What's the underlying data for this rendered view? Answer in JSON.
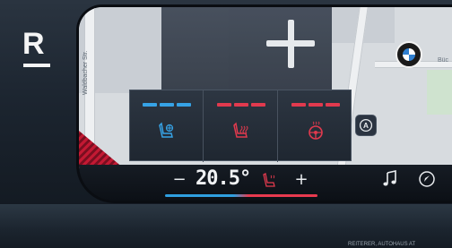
{
  "watermark": {
    "logo_letter": "R"
  },
  "map": {
    "street_label": "Waldbacher Str.",
    "right_label": "Büc"
  },
  "climate": {
    "buttons": [
      {
        "name": "seat-ventilation",
        "icon": "seat-fan-icon",
        "level_color": "#36a3e6",
        "levels_active": 3
      },
      {
        "name": "seat-heating",
        "icon": "seat-heat-icon",
        "level_color": "#e23a4e",
        "levels_active": 3
      },
      {
        "name": "steering-wheel-heating",
        "icon": "steering-wheel-heat-icon",
        "level_color": "#e23a4e",
        "levels_active": 3
      }
    ],
    "auto_label": "A"
  },
  "bottom_bar": {
    "minus": "−",
    "temperature": "20.5°",
    "plus": "+",
    "music_icon": "music-note-icon",
    "nav_icon": "navigation-icon"
  },
  "credit": "REITERER, AUTOHAUS AT",
  "colors": {
    "cool_blue": "#36a3e6",
    "warm_red": "#e23a4e",
    "panel_bg": "#2d3642"
  }
}
